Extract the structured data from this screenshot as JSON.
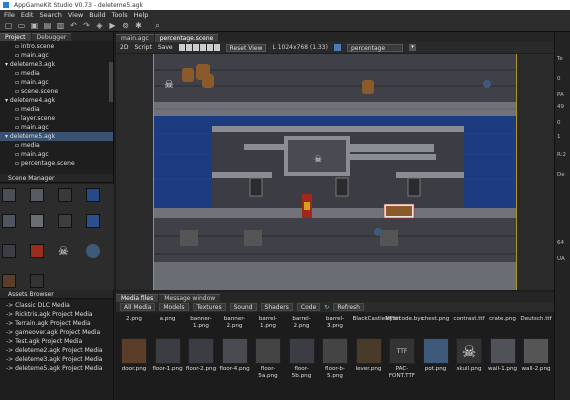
{
  "window": {
    "title": "AppGameKit Studio V0.73 - deleteme5.agk"
  },
  "menu": [
    "File",
    "Edit",
    "Search",
    "View",
    "Build",
    "Tools",
    "Help"
  ],
  "toolbar_icons": [
    "new-file-icon",
    "open-icon",
    "save-icon",
    "save-all-icon",
    "undo-icon",
    "redo-icon",
    "compile-icon",
    "run-icon",
    "broadcast-icon",
    "debug-icon",
    "search-icon"
  ],
  "left_top": {
    "tabs": [
      "Project",
      "Debugger"
    ],
    "tree": [
      {
        "label": "intro.scene",
        "indent": 3
      },
      {
        "label": "main.agc",
        "indent": 3
      },
      {
        "label": "deleteme3.agk",
        "indent": 1,
        "project": true
      },
      {
        "label": "media",
        "indent": 3
      },
      {
        "label": "main.agc",
        "indent": 3
      },
      {
        "label": "scene.scene",
        "indent": 3
      },
      {
        "label": "deleteme4.agk",
        "indent": 1,
        "project": true
      },
      {
        "label": "media",
        "indent": 3
      },
      {
        "label": "layer.scene",
        "indent": 3
      },
      {
        "label": "main.agc",
        "indent": 3
      },
      {
        "label": "deleteme5.agk",
        "indent": 1,
        "project": true,
        "selected": true
      },
      {
        "label": "media",
        "indent": 3
      },
      {
        "label": "main.agc",
        "indent": 3
      },
      {
        "label": "percentage.scene",
        "indent": 3
      }
    ]
  },
  "scene_manager": {
    "title": "Scene Manager"
  },
  "assets_browser": {
    "title": "Assets Browser",
    "items": [
      "-> Classic DLC Media",
      "-> Ricktris.agk Project Media",
      "-> Terrain.agk Project Media",
      "-> gameover.agk Project Media",
      "-> Test.agk Project Media",
      "-> deleteme2.agk Project Media",
      "-> deleteme3.agk Project Media",
      "-> deleteme5.agk Project Media"
    ]
  },
  "editor": {
    "tabs": [
      "main.agc",
      "percentage.scene"
    ],
    "active_tab": "percentage.scene",
    "mode_2d": "2D",
    "script": "Script",
    "save": "Save",
    "reset_view": "Reset View",
    "resolution": "L 1024x768 (1.33)",
    "scene_select": "percentage"
  },
  "media": {
    "tabs": [
      "Media files",
      "Message window"
    ],
    "filters": [
      "All Media",
      "Models",
      "Textures",
      "Sound",
      "Shaders",
      "Code"
    ],
    "refresh": "Refresh",
    "row1": [
      "2.png",
      "a.png",
      "banner-1.png",
      "banner-2.png",
      "barrel-1.png",
      "barrel-2.png",
      "barrel-3.png",
      "BlackCastleMF.ttf",
      "bytecode.byc",
      "chest.png",
      "contrast.ttf",
      "crate.png",
      "Deutsch.ttf"
    ],
    "row2": [
      "door.png",
      "floor-1.png",
      "floor-2.png",
      "floor-4.png",
      "floor-5a.png",
      "floor-5b.png",
      "floor-b-5.png",
      "lever.png",
      "PAC-FONT.TTF",
      "pot.png",
      "skull.png",
      "wall-1.png",
      "wall-2.png"
    ],
    "row2_thumb_text": {
      "ttf": "TTF"
    }
  },
  "right_panel": {
    "labels": [
      "Te",
      "0",
      "PA",
      "49",
      "0",
      "1",
      "R:2",
      "De",
      "64",
      "UA"
    ]
  },
  "colors": {
    "water": "#1e3a7a",
    "stone": "#6b6b6b",
    "floor": "#3d3d45",
    "accent": "#3a5170"
  }
}
